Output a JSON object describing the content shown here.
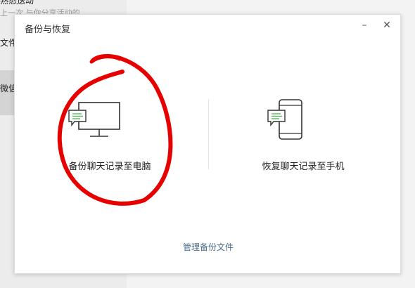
{
  "background": {
    "line1": "熟悉送动",
    "line2": "上一次  与你分享活动的",
    "line3": "文件",
    "line4": "微信"
  },
  "dialog": {
    "title": "备份与恢复",
    "minimize_symbol": "–",
    "close_symbol": "✕",
    "options": [
      {
        "label": "备份聊天记录至电脑",
        "icon": "computer-chat-icon"
      },
      {
        "label": "恢复聊天记录至手机",
        "icon": "phone-chat-icon"
      }
    ],
    "manage_link": "管理备份文件"
  },
  "colors": {
    "accent_green": "#5bb75b",
    "link_blue": "#4a6a8a",
    "annotation_red": "#e60000"
  }
}
